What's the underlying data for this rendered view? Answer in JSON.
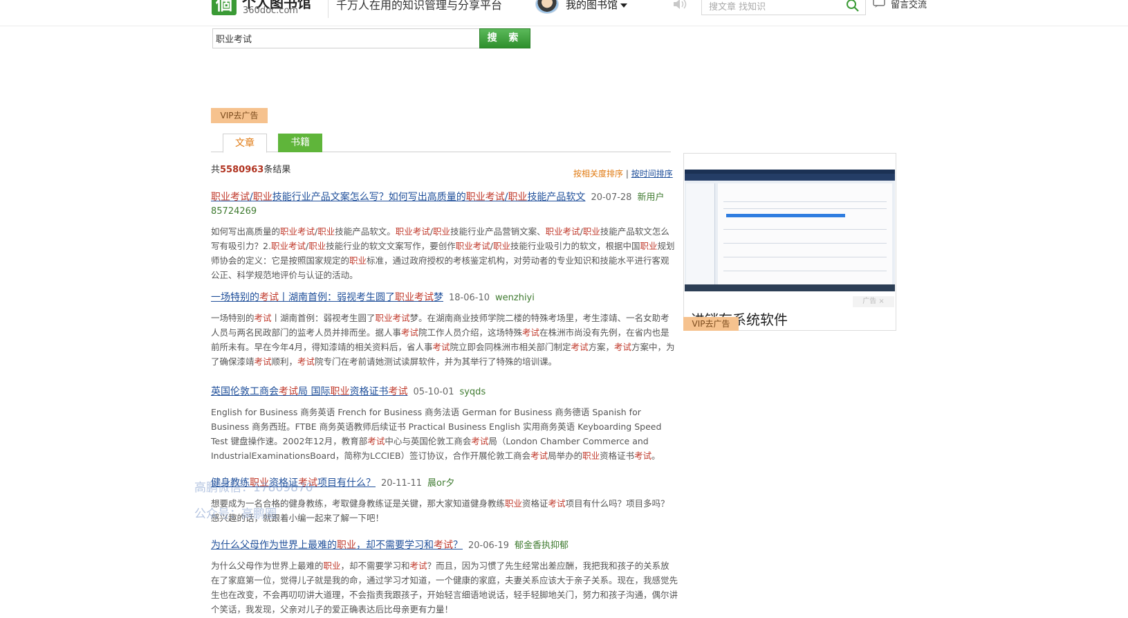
{
  "header": {
    "logo_glyph": "個",
    "logo_name": "个人图书馆",
    "logo_domain": "360doc.com",
    "slogan": "千万人在用的知识管理与分享平台",
    "my_library": "我的图书馆",
    "search_placeholder": "搜文章 找知识",
    "messages": "留言交流"
  },
  "search": {
    "query": "职业考试",
    "button": "搜 索"
  },
  "vip_ad": "VIP去广告",
  "tabs": {
    "articles": "文章",
    "books": "书籍"
  },
  "results_summary": {
    "prefix": "共",
    "count": "5580963",
    "suffix": "条结果"
  },
  "sort": {
    "relevance": "按相关度排序",
    "separator": "|",
    "time": "按时间排序"
  },
  "results": [
    {
      "title": "职业考试/职业技能行业产品文案怎么写？如何写出高质量的职业考试/职业技能产品软文",
      "date": "20-07-28",
      "author": "新用户",
      "author2": "85724269",
      "excerpt": "如何写出高质量的职业考试/职业技能产品软文。职业考试/职业技能行业产品营销文案、职业考试/职业技能产品软文怎么写有吸引力？2.职业考试/职业技能行业的软文文案写作，要创作职业考试/职业技能行业吸引力的软文，根据中国职业规划师协会的定义：它是按照国家规定的职业标准，通过政府授权的考核鉴定机构，对劳动者的专业知识和技能水平进行客观公正、科学规范地评价与认证的活动。"
    },
    {
      "title": "一场特别的考试丨湖南首例：弱视考生圆了职业考试梦",
      "date": "18-06-10",
      "author": "wenzhiyi",
      "excerpt": "一场特别的考试丨湖南首例：弱视考生圆了职业考试梦。在湖南商业技师学院二楼的特殊考场里，考生漆靖、一名女助考人员与两名民政部门的监考人员并排而坐。据人事考试院工作人员介绍，这场特殊考试在株洲市尚没有先例，在省内也是前所未有。早在今年4月，得知漆靖的相关资料后，省人事考试院立即会同株洲市相关部门制定考试方案，考试方案中，为了确保漆靖考试顺利，考试院专门在考前请她测试读屏软件，并为其举行了特殊的培训课。"
    },
    {
      "title": "英国伦敦工商会考试局 国际职业资格证书考试",
      "date": "05-10-01",
      "author": "syqds",
      "excerpt": "English for Business 商务英语 French for Business 商务法语 German for Business 商务德语 Spanish for Business 商务西班。FTBE 商务英语教师后续证书 Practical Business English 实用商务英语 Keyboarding Speed Test 键盘操作速。2002年12月，教育部考试中心与英国伦敦工商会考试局（London Chamber Commerce and IndustrialExaminationsBoard，简称为LCCIEB）签订协议，合作开展伦敦工商会考试局举办的职业资格证书考试。"
    },
    {
      "title": "健身教练职业资格证考试项目有什么？",
      "date": "20-11-11",
      "author": "晨or夕",
      "excerpt": "想要成为一名合格的健身教练，考取健身教练证是关键，那大家知道健身教练职业资格证考试项目有什么吗？项目多吗？感兴趣的话，就跟着小编一起来了解一下吧！"
    },
    {
      "title": "为什么父母作为世界上最难的职业，却不需要学习和考试？",
      "date": "20-06-19",
      "author": "郁金香执抑郁",
      "excerpt": "为什么父母作为世界上最难的职业，却不需要学习和考试？而且，因为习惯了先生经常出差应酬，我把我和孩子的关系放在了家庭第一位，觉得儿子就是我的命，通过学习才知道，一个健康的家庭，夫妻关系应该大于亲子关系。现在，我感觉先生也在改变，不会再叨叨讲大道理，不会指责我跟孩子，开始轻言细语地说话，轻手轻脚地关门，努力和孩子沟通，偶尔讲个笑话，我发现，父亲对儿子的爱正确表达后比母亲更有力量！"
    }
  ],
  "side_ad": {
    "close_label": "广告 ×",
    "caption": "进销存系统软件",
    "vip": "VIP去广告"
  },
  "watermark": {
    "line1": "高鹏微信：17809870",
    "line2": "公众号：高鹏圈"
  },
  "colors": {
    "brand_green": "#3a9a35",
    "link_blue": "#1f4f9a",
    "highlight_red": "#c0392b",
    "orange": "#e07a12"
  }
}
